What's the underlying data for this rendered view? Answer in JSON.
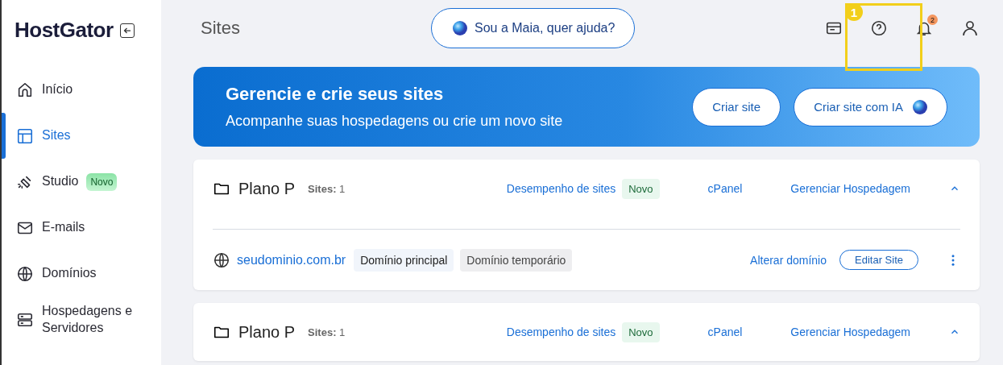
{
  "sidebar": {
    "logo": "HostGator",
    "items": [
      {
        "label": "Início",
        "selected": false
      },
      {
        "label": "Sites",
        "selected": true
      },
      {
        "label": "Studio",
        "selected": false,
        "badge": "Novo"
      },
      {
        "label": "E-mails",
        "selected": false
      },
      {
        "label": "Domínios",
        "selected": false
      },
      {
        "label": "Hospedagens e Servidores",
        "selected": false
      }
    ]
  },
  "header": {
    "title": "Sites",
    "assistant_button": "Sou a Maia, quer ajuda?",
    "notification_count": "2",
    "annotation": "1"
  },
  "banner": {
    "title": "Gerencie e crie seus sites",
    "subtitle": "Acompanhe suas hospedagens ou crie um novo site",
    "buttons": [
      {
        "label": "Criar site",
        "kind": "plain"
      },
      {
        "label": "Criar site com IA",
        "kind": "ai"
      }
    ]
  },
  "plans": [
    {
      "name": "Plano P",
      "sites_label": "Sites:",
      "sites_count": "1",
      "performance_link": "Desempenho de sites",
      "performance_badge": "Novo",
      "cpanel_link": "cPanel",
      "manage_link": "Gerenciar Hospedagem",
      "expanded": true,
      "sites": [
        {
          "domain": "seudominio.com.br",
          "tags": [
            {
              "label": "Domínio principal",
              "kind": "primary"
            },
            {
              "label": "Domínio temporário",
              "kind": "temporary"
            }
          ],
          "change_link": "Alterar domínio",
          "edit_button": "Editar Site"
        }
      ]
    },
    {
      "name": "Plano P",
      "sites_label": "Sites:",
      "sites_count": "1",
      "performance_link": "Desempenho de sites",
      "performance_badge": "Novo",
      "cpanel_link": "cPanel",
      "manage_link": "Gerenciar Hospedagem",
      "expanded": true
    }
  ]
}
